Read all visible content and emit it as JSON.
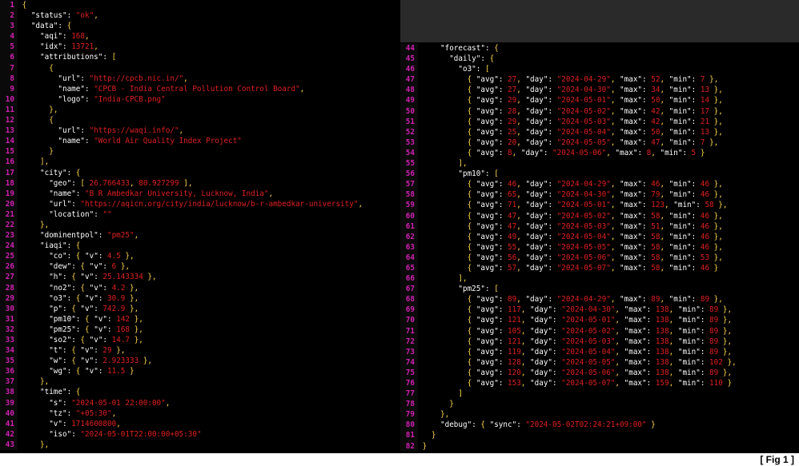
{
  "colors": {
    "background": "#000000",
    "line_number": "#d020b0",
    "key": "#ffffff",
    "string": "#e02020",
    "punct": "#ffd84a"
  },
  "figure_label": "[ Fig 1 ]",
  "left_lines": [
    {
      "n": "1",
      "t": "{"
    },
    {
      "n": "2",
      "t": "  \"status\": \"ok\","
    },
    {
      "n": "3",
      "t": "  \"data\": {"
    },
    {
      "n": "4",
      "t": "    \"aqi\": 168,"
    },
    {
      "n": "5",
      "t": "    \"idx\": 13721,"
    },
    {
      "n": "6",
      "t": "    \"attributions\": ["
    },
    {
      "n": "7",
      "t": "      {"
    },
    {
      "n": "8",
      "t": "        \"url\": \"http://cpcb.nic.in/\","
    },
    {
      "n": "9",
      "t": "        \"name\": \"CPCB - India Central Pollution Control Board\","
    },
    {
      "n": "10",
      "t": "        \"logo\": \"India-CPCB.png\""
    },
    {
      "n": "11",
      "t": "      },"
    },
    {
      "n": "12",
      "t": "      {"
    },
    {
      "n": "13",
      "t": "        \"url\": \"https://waqi.info/\","
    },
    {
      "n": "14",
      "t": "        \"name\": \"World Air Quality Index Project\""
    },
    {
      "n": "15",
      "t": "      }"
    },
    {
      "n": "16",
      "t": "    ],"
    },
    {
      "n": "17",
      "t": "    \"city\": {"
    },
    {
      "n": "18",
      "t": "      \"geo\": [ 26.766433, 80.927299 ],"
    },
    {
      "n": "19",
      "t": "      \"name\": \"B R Ambedkar University, Lucknow, India\","
    },
    {
      "n": "20",
      "t": "      \"url\": \"https://aqicn.org/city/india/lucknow/b-r-ambedkar-university\","
    },
    {
      "n": "21",
      "t": "      \"location\": \"\""
    },
    {
      "n": "22",
      "t": "    },"
    },
    {
      "n": "23",
      "t": "    \"dominentpol\": \"pm25\","
    },
    {
      "n": "24",
      "t": "    \"iaqi\": {"
    },
    {
      "n": "25",
      "t": "      \"co\": { \"v\": 4.5 },"
    },
    {
      "n": "26",
      "t": "      \"dew\": { \"v\": 6 },"
    },
    {
      "n": "27",
      "t": "      \"h\": { \"v\": 25.143334 },"
    },
    {
      "n": "28",
      "t": "      \"no2\": { \"v\": 4.2 },"
    },
    {
      "n": "29",
      "t": "      \"o3\": { \"v\": 30.9 },"
    },
    {
      "n": "30",
      "t": "      \"p\": { \"v\": 742.9 },"
    },
    {
      "n": "31",
      "t": "      \"pm10\": { \"v\": 142 },"
    },
    {
      "n": "32",
      "t": "      \"pm25\": { \"v\": 168 },"
    },
    {
      "n": "33",
      "t": "      \"so2\": { \"v\": 14.7 },"
    },
    {
      "n": "34",
      "t": "      \"t\": { \"v\": 29 },"
    },
    {
      "n": "35",
      "t": "      \"w\": { \"v\": 2.923333 },"
    },
    {
      "n": "36",
      "t": "      \"wg\": { \"v\": 11.5 }"
    },
    {
      "n": "37",
      "t": "    },"
    },
    {
      "n": "38",
      "t": "    \"time\": {"
    },
    {
      "n": "39",
      "t": "      \"s\": \"2024-05-01 22:00:00\","
    },
    {
      "n": "40",
      "t": "      \"tz\": \"+05:30\","
    },
    {
      "n": "41",
      "t": "      \"v\": 1714600800,"
    },
    {
      "n": "42",
      "t": "      \"iso\": \"2024-05-01T22:00:00+05:30\""
    },
    {
      "n": "43",
      "t": "    },"
    }
  ],
  "right_lines": [
    {
      "n": "44",
      "t": "    \"forecast\": {"
    },
    {
      "n": "45",
      "t": "      \"daily\": {"
    },
    {
      "n": "46",
      "t": "        \"o3\": ["
    },
    {
      "n": "47",
      "t": "          { \"avg\": 27, \"day\": \"2024-04-29\", \"max\": 52, \"min\": 7 },"
    },
    {
      "n": "48",
      "t": "          { \"avg\": 27, \"day\": \"2024-04-30\", \"max\": 34, \"min\": 13 },"
    },
    {
      "n": "49",
      "t": "          { \"avg\": 29, \"day\": \"2024-05-01\", \"max\": 50, \"min\": 14 },"
    },
    {
      "n": "50",
      "t": "          { \"avg\": 28, \"day\": \"2024-05-02\", \"max\": 42, \"min\": 17 },"
    },
    {
      "n": "51",
      "t": "          { \"avg\": 29, \"day\": \"2024-05-03\", \"max\": 42, \"min\": 21 },"
    },
    {
      "n": "52",
      "t": "          { \"avg\": 25, \"day\": \"2024-05-04\", \"max\": 50, \"min\": 13 },"
    },
    {
      "n": "53",
      "t": "          { \"avg\": 20, \"day\": \"2024-05-05\", \"max\": 47, \"min\": 7 },"
    },
    {
      "n": "54",
      "t": "          { \"avg\": 8, \"day\": \"2024-05-06\", \"max\": 8, \"min\": 5 }"
    },
    {
      "n": "55",
      "t": "        ],"
    },
    {
      "n": "56",
      "t": "        \"pm10\": ["
    },
    {
      "n": "57",
      "t": "          { \"avg\": 46, \"day\": \"2024-04-29\", \"max\": 46, \"min\": 46 },"
    },
    {
      "n": "58",
      "t": "          { \"avg\": 65, \"day\": \"2024-04-30\", \"max\": 79, \"min\": 46 },"
    },
    {
      "n": "59",
      "t": "          { \"avg\": 71, \"day\": \"2024-05-01\", \"max\": 123, \"min\": 58 },"
    },
    {
      "n": "60",
      "t": "          { \"avg\": 47, \"day\": \"2024-05-02\", \"max\": 58, \"min\": 46 },"
    },
    {
      "n": "61",
      "t": "          { \"avg\": 47, \"day\": \"2024-05-03\", \"max\": 51, \"min\": 46 },"
    },
    {
      "n": "62",
      "t": "          { \"avg\": 49, \"day\": \"2024-05-04\", \"max\": 58, \"min\": 46 },"
    },
    {
      "n": "63",
      "t": "          { \"avg\": 55, \"day\": \"2024-05-05\", \"max\": 58, \"min\": 46 },"
    },
    {
      "n": "64",
      "t": "          { \"avg\": 56, \"day\": \"2024-05-06\", \"max\": 58, \"min\": 53 },"
    },
    {
      "n": "65",
      "t": "          { \"avg\": 57, \"day\": \"2024-05-07\", \"max\": 58, \"min\": 46 }"
    },
    {
      "n": "66",
      "t": "        ],"
    },
    {
      "n": "67",
      "t": "        \"pm25\": ["
    },
    {
      "n": "68",
      "t": "          { \"avg\": 89, \"day\": \"2024-04-29\", \"max\": 89, \"min\": 89 },"
    },
    {
      "n": "69",
      "t": "          { \"avg\": 117, \"day\": \"2024-04-30\", \"max\": 138, \"min\": 89 },"
    },
    {
      "n": "70",
      "t": "          { \"avg\": 121, \"day\": \"2024-05-01\", \"max\": 138, \"min\": 89 },"
    },
    {
      "n": "71",
      "t": "          { \"avg\": 105, \"day\": \"2024-05-02\", \"max\": 138, \"min\": 89 },"
    },
    {
      "n": "72",
      "t": "          { \"avg\": 121, \"day\": \"2024-05-03\", \"max\": 138, \"min\": 89 },"
    },
    {
      "n": "73",
      "t": "          { \"avg\": 119, \"day\": \"2024-05-04\", \"max\": 138, \"min\": 89 },"
    },
    {
      "n": "74",
      "t": "          { \"avg\": 128, \"day\": \"2024-05-05\", \"max\": 138, \"min\": 102 },"
    },
    {
      "n": "75",
      "t": "          { \"avg\": 120, \"day\": \"2024-05-06\", \"max\": 138, \"min\": 89 },"
    },
    {
      "n": "76",
      "t": "          { \"avg\": 153, \"day\": \"2024-05-07\", \"max\": 159, \"min\": 110 }"
    },
    {
      "n": "77",
      "t": "        ]"
    },
    {
      "n": "78",
      "t": "      }"
    },
    {
      "n": "79",
      "t": "    },"
    },
    {
      "n": "80",
      "t": "    \"debug\": { \"sync\": \"2024-05-02T02:24:21+09:00\" }"
    },
    {
      "n": "81",
      "t": "  }"
    },
    {
      "n": "82",
      "t": "}"
    }
  ]
}
